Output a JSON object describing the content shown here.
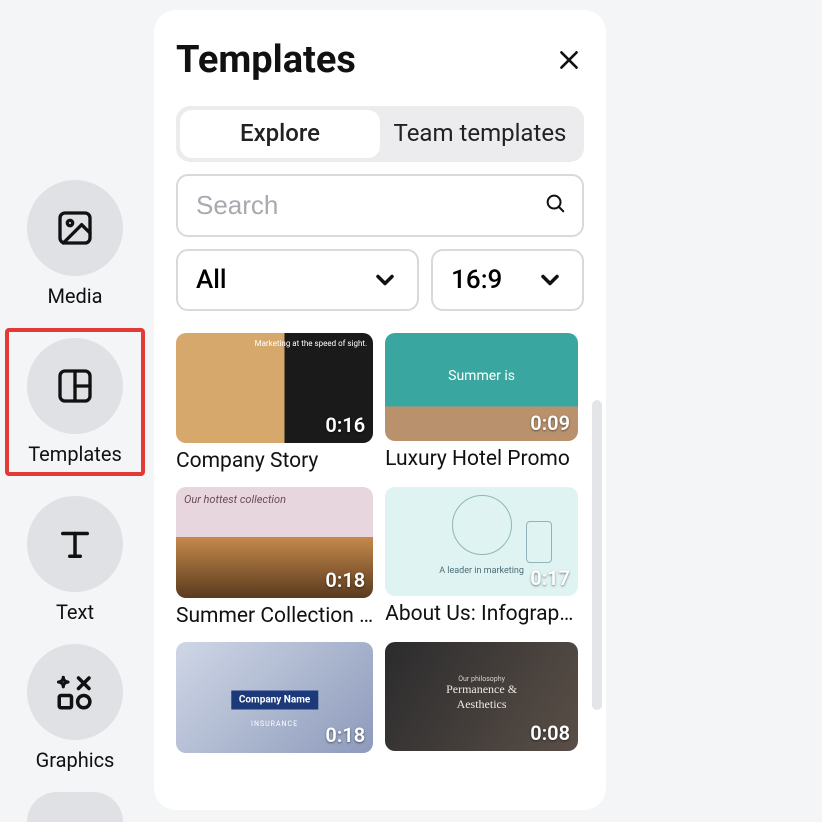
{
  "sidebar": {
    "items": [
      {
        "id": "media",
        "label": "Media"
      },
      {
        "id": "templates",
        "label": "Templates"
      },
      {
        "id": "text",
        "label": "Text"
      },
      {
        "id": "graphics",
        "label": "Graphics"
      }
    ]
  },
  "panel": {
    "title": "Templates",
    "tabs": [
      {
        "label": "Explore",
        "active": true
      },
      {
        "label": "Team templates",
        "active": false
      }
    ],
    "search": {
      "placeholder": "Search",
      "value": ""
    },
    "filters": {
      "category": "All",
      "ratio": "16:9"
    },
    "templates": [
      {
        "title": "Company Story",
        "duration": "0:16",
        "overlay": "Marketing at the speed of sight."
      },
      {
        "title": "Luxury Hotel Promo",
        "duration": "0:09",
        "overlay": "Summer is"
      },
      {
        "title": "Summer Collection …",
        "duration": "0:18",
        "overlay": "Our hottest collection"
      },
      {
        "title": "About Us: Infograp…",
        "duration": "0:17",
        "overlay": "A leader in marketing"
      },
      {
        "title": "",
        "duration": "0:18",
        "overlay": "Company Name",
        "overlay2": "INSURANCE"
      },
      {
        "title": "",
        "duration": "0:08",
        "overlay0": "Our philosophy",
        "overlay": "Permanence & Aesthetics"
      }
    ]
  }
}
